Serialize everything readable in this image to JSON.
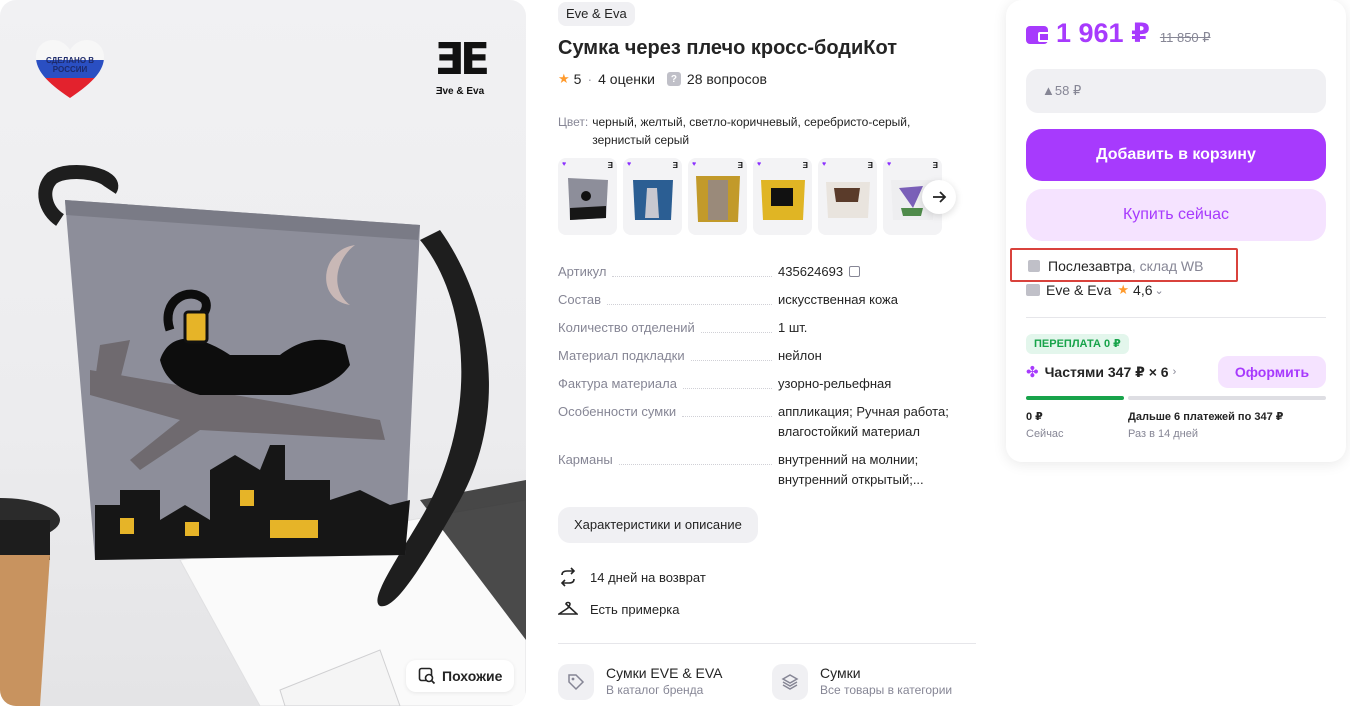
{
  "gallery": {
    "made_in_russia": "СДЕЛАНО В РОССИИ",
    "brand_logo_mark": "ƎE",
    "brand_logo_name": "Ǝve & Eva",
    "similar_label": "Похожие",
    "icons": {
      "similar": "image-search-icon"
    }
  },
  "product": {
    "brand": "Eve & Eva",
    "title": "Сумка через плечо кросс-бодиКот",
    "rating": "5",
    "ratings_count": "4 оценки",
    "questions_count": "28 вопросов",
    "color_label": "Цвет:",
    "color_value": "черный, желтый, светло-коричневый, серебристо-серый, зернистый серый"
  },
  "specs": [
    {
      "key": "Артикул",
      "value": "435624693"
    },
    {
      "key": "Состав",
      "value": "искусственная кожа"
    },
    {
      "key": "Количество отделений",
      "value": "1 шт."
    },
    {
      "key": "Материал подкладки",
      "value": "нейлон"
    },
    {
      "key": "Фактура материала",
      "value": "узорно-рельефная"
    },
    {
      "key": "Особенности сумки",
      "value": "аппликация; Ручная работа; влагостойкий материал"
    },
    {
      "key": "Карманы",
      "value": "внутренний на молнии; внутренний открытый;..."
    }
  ],
  "actions": {
    "characteristics_button": "Характеристики и описание",
    "return_text": "14 дней на возврат",
    "fitting_text": "Есть примерка"
  },
  "categories": [
    {
      "title": "Сумки EVE & EVA",
      "subtitle": "В каталог бренда"
    },
    {
      "title": "Сумки",
      "subtitle": "Все товары в категории"
    }
  ],
  "buy_card": {
    "price": "1 961 ₽",
    "old_price": "11 850 ₽",
    "price_drop": "▲58 ₽",
    "add_to_cart": "Добавить в корзину",
    "buy_now": "Купить сейчас",
    "delivery_day": "Послезавтра",
    "delivery_warehouse": ", склад WB",
    "seller_name": "Eve & Eva",
    "seller_rating": "4,6",
    "overpay_badge": "ПЕРЕПЛАТА 0 ₽",
    "installments": "Частями 347 ₽ × 6",
    "order_button": "Оформить",
    "now_amount": "0 ₽",
    "now_label": "Сейчас",
    "later_amount": "Дальше 6 платежей по 347 ₽",
    "later_label": "Раз в 14 дней"
  },
  "colors": {
    "accent": "#a73afd",
    "accent_soft": "#f5e3ff",
    "success": "#17a34a",
    "highlight_border": "#d9423c"
  }
}
